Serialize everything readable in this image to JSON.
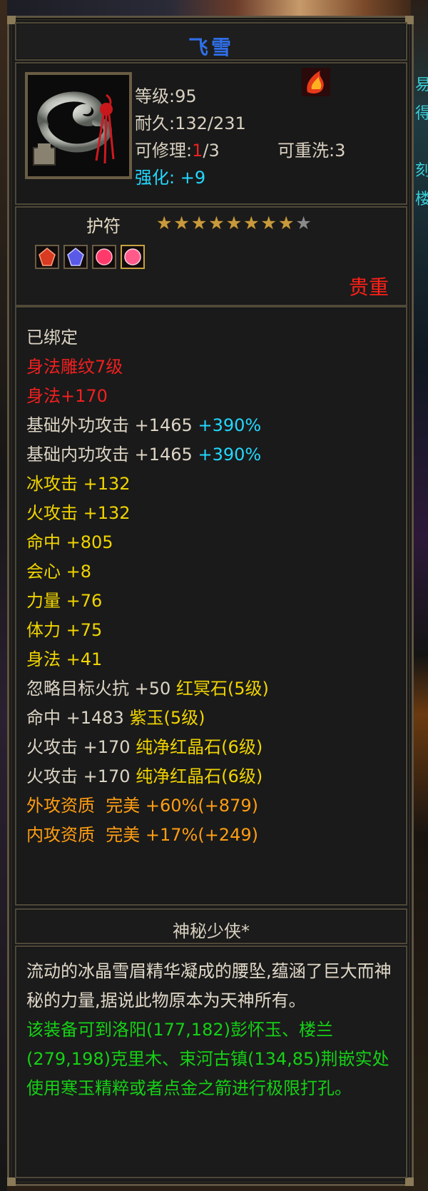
{
  "item": {
    "name": "飞雪",
    "level_label": "等级",
    "level": ":95",
    "durability_label": "耐久",
    "durability": ":132/231",
    "repair_label": "可修理:",
    "repair_used": "1",
    "repair_total": "/3",
    "rewash_label": "可重洗",
    "rewash": ":3",
    "enhance_label": "强化:",
    "enhance": "+9"
  },
  "equip_type": {
    "label": "护符",
    "stars_filled": 8,
    "stars_total": 9
  },
  "gems": [
    {
      "name": "red-gem-icon",
      "color": "#e0402a"
    },
    {
      "name": "blue-gem-icon",
      "color": "#6a6aff"
    },
    {
      "name": "pink-gem-icon",
      "color": "#ff4a78"
    },
    {
      "name": "pink-gem-icon",
      "color": "#ff6a8a"
    }
  ],
  "quality": "贵重",
  "attributes": {
    "bound": "已绑定",
    "engrave": "身法雕纹7级",
    "engrave_bonus": "身法+170",
    "base_ext_label": "基础外功攻击",
    "base_ext_value": " +1465",
    "base_ext_pct": " +390%",
    "base_int_label": "基础内功攻击",
    "base_int_value": " +1465",
    "base_int_pct": " +390%",
    "ice": "冰攻击 +132",
    "fire": "火攻击 +132",
    "hit": "命中 +805",
    "crit": "会心 +8",
    "str": "力量 +76",
    "con": "体力 +75",
    "agi": "身法 +41",
    "gem1_stat": "忽略目标火抗 +50 ",
    "gem1_name": "红冥石(5级)",
    "gem2_stat": "命中 +1483 ",
    "gem2_name": "紫玉(5级)",
    "gem3_stat": "火攻击 +170 ",
    "gem3_name": "纯净红晶石(6级)",
    "gem4_stat": "火攻击 +170 ",
    "gem4_name": "纯净红晶石(6级)",
    "ext_aptitude": "外攻资质  完美 +60%(+879)",
    "int_aptitude": "内攻资质  完美 +17%(+249)"
  },
  "set_name": "神秘少侠*",
  "description": {
    "lore": "流动的冰晶雪眉精华凝成的腰坠,蕴涵了巨大而神秘的力量,据说此物原本为天神所有。",
    "hint": "该装备可到洛阳(177,182)彭怀玉、楼兰(279,198)克里木、束河古镇(134,85)荆嵌实处使用寒玉精粹或者点金之箭进行极限打孔。"
  },
  "edge_glyphs": [
    "易",
    "得",
    "刻",
    "楼"
  ]
}
